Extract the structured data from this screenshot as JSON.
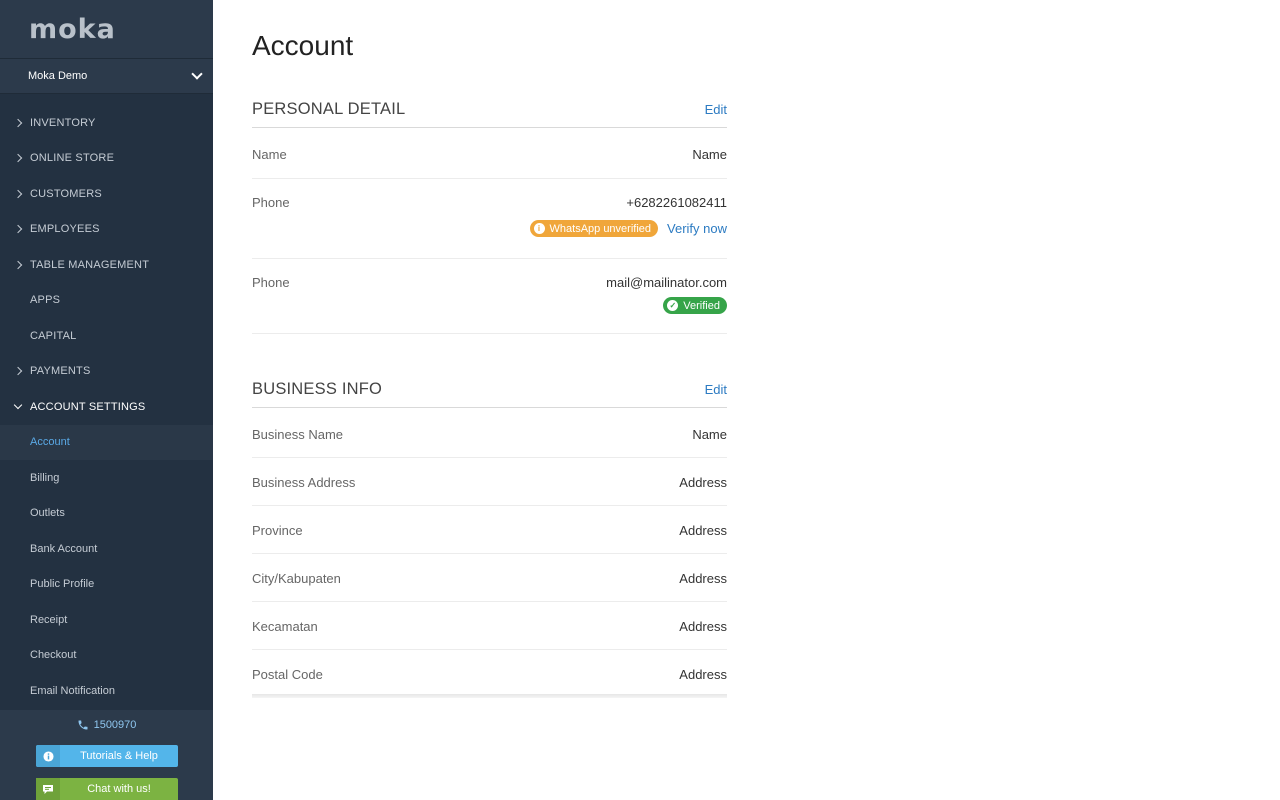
{
  "sidebar": {
    "logo": "moka",
    "outlet": "Moka Demo",
    "menu": [
      {
        "label": "INVENTORY"
      },
      {
        "label": "ONLINE STORE"
      },
      {
        "label": "CUSTOMERS"
      },
      {
        "label": "EMPLOYEES"
      },
      {
        "label": "TABLE MANAGEMENT"
      },
      {
        "label": "APPS"
      },
      {
        "label": "CAPITAL"
      },
      {
        "label": "PAYMENTS"
      },
      {
        "label": "ACCOUNT SETTINGS"
      }
    ],
    "submenu": [
      {
        "label": "Account"
      },
      {
        "label": "Billing"
      },
      {
        "label": "Outlets"
      },
      {
        "label": "Bank Account"
      },
      {
        "label": "Public Profile"
      },
      {
        "label": "Receipt"
      },
      {
        "label": "Checkout"
      },
      {
        "label": "Email Notification"
      }
    ],
    "phone": "1500970",
    "help_label": "Tutorials & Help",
    "chat_label": "Chat with us!",
    "accent": "#5aa9e6"
  },
  "main": {
    "title": "Account",
    "personal": {
      "title": "PERSONAL DETAIL",
      "edit": "Edit",
      "name_label": "Name",
      "name_value": "Name",
      "phone_label": "Phone",
      "phone_value": "+6282261082411",
      "whatsapp_badge": "WhatsApp unverified",
      "verify_link": "Verify now",
      "email_label": "Phone",
      "email_value": "mail@mailinator.com",
      "verified_badge": "Verified"
    },
    "business": {
      "title": "BUSINESS INFO",
      "edit": "Edit",
      "rows": [
        {
          "label": "Business Name",
          "value": "Name"
        },
        {
          "label": "Business Address",
          "value": "Address"
        },
        {
          "label": "Province",
          "value": "Address"
        },
        {
          "label": "City/Kabupaten",
          "value": "Address"
        },
        {
          "label": "Kecamatan",
          "value": "Address"
        },
        {
          "label": "Postal Code",
          "value": "Address"
        }
      ]
    }
  }
}
